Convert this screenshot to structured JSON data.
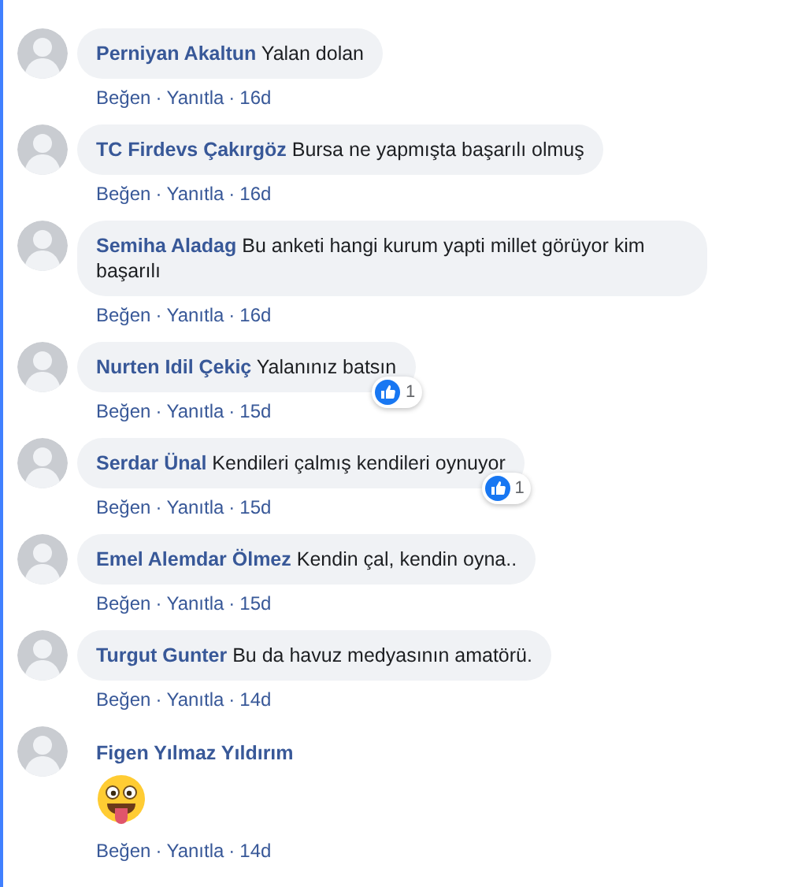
{
  "comments": [
    {
      "name": "Perniyan Akaltun",
      "text": "Yalan dolan",
      "kind": "text",
      "actions": [
        "Beğen",
        "·",
        "Yanıtla",
        "·",
        "16d"
      ]
    },
    {
      "name": "TC Firdevs Çakırgöz",
      "text": "Bursa ne yapmışta başarılı olmuş",
      "kind": "text",
      "actions": [
        "Beğen",
        "·",
        "Yanıtla",
        "·",
        "16d"
      ]
    },
    {
      "name": "Semiha Aladag",
      "text": "Bu anketi hangi kurum yapti millet görüyor kim başarılı",
      "kind": "text",
      "actions": [
        "Beğen",
        "·",
        "Yanıtla",
        "·",
        "16d"
      ]
    },
    {
      "name": "Nurten Idil Çekiç",
      "text": "Yalanınız batsın",
      "kind": "text",
      "likes": "1",
      "actions": [
        "Beğen",
        "·",
        "Yanıtla",
        "·",
        "15d"
      ]
    },
    {
      "name": "Serdar Ünal",
      "text": "Kendileri çalmış kendileri oynuyor",
      "kind": "text",
      "likes": "1",
      "actions": [
        "Beğen",
        "·",
        "Yanıtla",
        "·",
        "15d"
      ]
    },
    {
      "name": "Emel Alemdar Ölmez",
      "text": "Kendin çal, kendin oyna..",
      "kind": "text",
      "actions": [
        "Beğen",
        "·",
        "Yanıtla",
        "·",
        "15d"
      ]
    },
    {
      "name": "Turgut Gunter",
      "text": "Bu da havuz medyasının amatörü.",
      "kind": "text",
      "actions": [
        "Beğen",
        "·",
        "Yanıtla",
        "·",
        "14d"
      ]
    },
    {
      "name": "Figen Yılmaz Yıldırım",
      "kind": "emoji",
      "actions": [
        "Beğen",
        "·",
        "Yanıtla",
        "·",
        "14d"
      ]
    }
  ]
}
